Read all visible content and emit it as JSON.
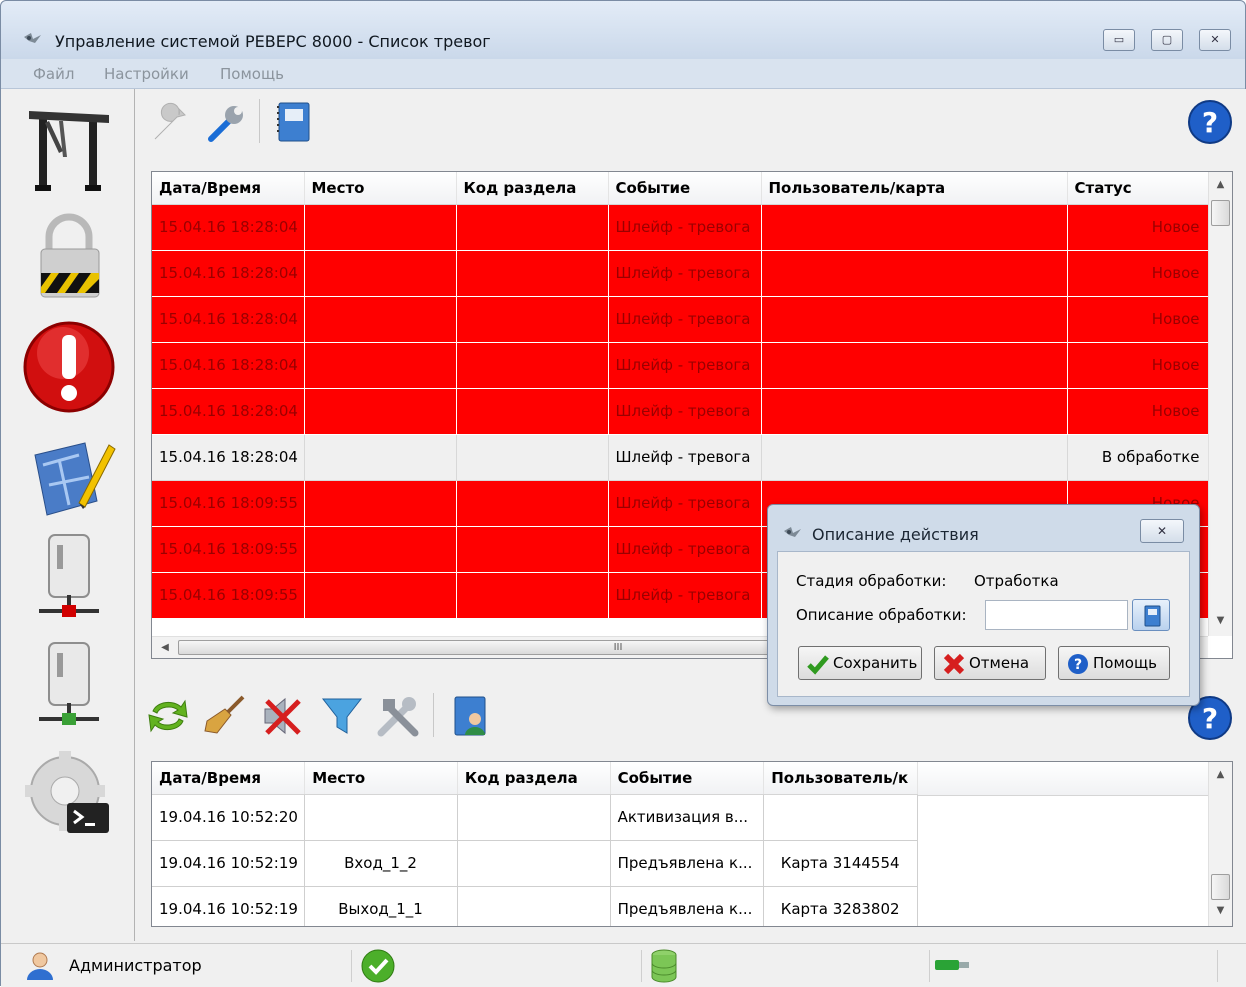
{
  "window": {
    "title": "Управление системой РЕВЕРС 8000 - Список тревог",
    "controls": {
      "minimize": "▭",
      "maximize": "▢",
      "close": "✕"
    }
  },
  "menu": [
    "Файл",
    "Настройки",
    "Помощь"
  ],
  "nav_icons": [
    "turnstile-icon",
    "padlock-icon",
    "alarm-icon",
    "map-edit-icon",
    "server-disconnected-icon",
    "server-connected-icon",
    "console-settings-icon"
  ],
  "alarms_table": {
    "columns": [
      "Дата/Время",
      "Место",
      "Код раздела",
      "Событие",
      "Пользователь/карта",
      "Статус"
    ],
    "rows": [
      {
        "datetime": "15.04.16 18:28:04",
        "place": "",
        "code": "",
        "event": "Шлейф - тревога",
        "user": "",
        "status": "Новое",
        "state": "alarm"
      },
      {
        "datetime": "15.04.16 18:28:04",
        "place": "",
        "code": "",
        "event": "Шлейф - тревога",
        "user": "",
        "status": "Новое",
        "state": "alarm"
      },
      {
        "datetime": "15.04.16 18:28:04",
        "place": "",
        "code": "",
        "event": "Шлейф - тревога",
        "user": "",
        "status": "Новое",
        "state": "alarm"
      },
      {
        "datetime": "15.04.16 18:28:04",
        "place": "",
        "code": "",
        "event": "Шлейф - тревога",
        "user": "",
        "status": "Новое",
        "state": "alarm"
      },
      {
        "datetime": "15.04.16 18:28:04",
        "place": "",
        "code": "",
        "event": "Шлейф - тревога",
        "user": "",
        "status": "Новое",
        "state": "alarm"
      },
      {
        "datetime": "15.04.16 18:28:04",
        "place": "",
        "code": "",
        "event": "Шлейф - тревога",
        "user": "",
        "status": "В обработке",
        "state": "normal"
      },
      {
        "datetime": "15.04.16 18:09:55",
        "place": "",
        "code": "",
        "event": "Шлейф - тревога",
        "user": "",
        "status": "Новое",
        "state": "alarm"
      },
      {
        "datetime": "15.04.16 18:09:55",
        "place": "",
        "code": "",
        "event": "Шлейф - тревога",
        "user": "",
        "status": "",
        "state": "alarm"
      },
      {
        "datetime": "15.04.16 18:09:55",
        "place": "",
        "code": "",
        "event": "Шлейф - тревога",
        "user": "",
        "status": "",
        "state": "alarm"
      }
    ],
    "hscroll_grip": "III"
  },
  "events_table": {
    "columns": [
      "Дата/Время",
      "Место",
      "Код раздела",
      "Событие",
      "Пользователь/к"
    ],
    "rows": [
      {
        "datetime": "19.04.16 10:52:20",
        "place": "",
        "code": "",
        "event": "Активизация в...",
        "user": ""
      },
      {
        "datetime": "19.04.16 10:52:19",
        "place": "Вход_1_2",
        "code": "",
        "event": "Предъявлена к...",
        "user": "Карта 3144554"
      },
      {
        "datetime": "19.04.16 10:52:19",
        "place": "Выход_1_1",
        "code": "",
        "event": "Предъявлена к...",
        "user": "Карта 3283802"
      }
    ]
  },
  "dialog": {
    "title": "Описание действия",
    "stage_label": "Стадия обработки:",
    "stage_value": "Отработка",
    "desc_label": "Описание обработки:",
    "desc_value": "",
    "save": "Сохранить",
    "cancel": "Отмена",
    "help": "Помощь"
  },
  "status": {
    "user": "Администратор"
  },
  "colors": {
    "alarm_row": "#ff0000",
    "alarm_text": "#9a0000",
    "help_blue": "#1f5fc8"
  }
}
